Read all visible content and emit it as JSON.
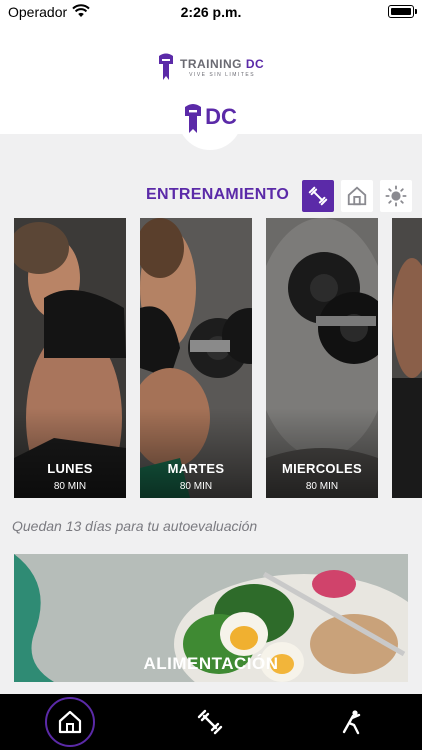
{
  "status_bar": {
    "carrier": "Operador",
    "time": "2:26 p.m."
  },
  "header": {
    "brand_word_1": "TRAINING",
    "brand_word_2": "DC",
    "brand_tagline": "VIVE SIN LIMITES",
    "badge_text": "DC"
  },
  "section": {
    "title": "ENTRENAMIENTO",
    "tabs": [
      {
        "icon": "dumbbell-icon",
        "active": true
      },
      {
        "icon": "home-icon",
        "active": false
      },
      {
        "icon": "sun-icon",
        "active": false
      }
    ]
  },
  "workouts": [
    {
      "day": "LUNES",
      "duration": "80 MIN"
    },
    {
      "day": "MARTES",
      "duration": "80 MIN"
    },
    {
      "day": "MIERCOLES",
      "duration": "80 MIN"
    }
  ],
  "self_eval_note": "Quedan 13 días para tu autoevaluación",
  "nutrition": {
    "label": "ALIMENTACIÓN"
  },
  "bottom_nav": [
    {
      "icon": "home-icon",
      "active": true
    },
    {
      "icon": "dumbbell-icon",
      "active": false
    },
    {
      "icon": "stretch-icon",
      "active": false
    }
  ],
  "colors": {
    "accent": "#5b2aa8",
    "background": "#f0f0f1",
    "nav": "#000000"
  }
}
